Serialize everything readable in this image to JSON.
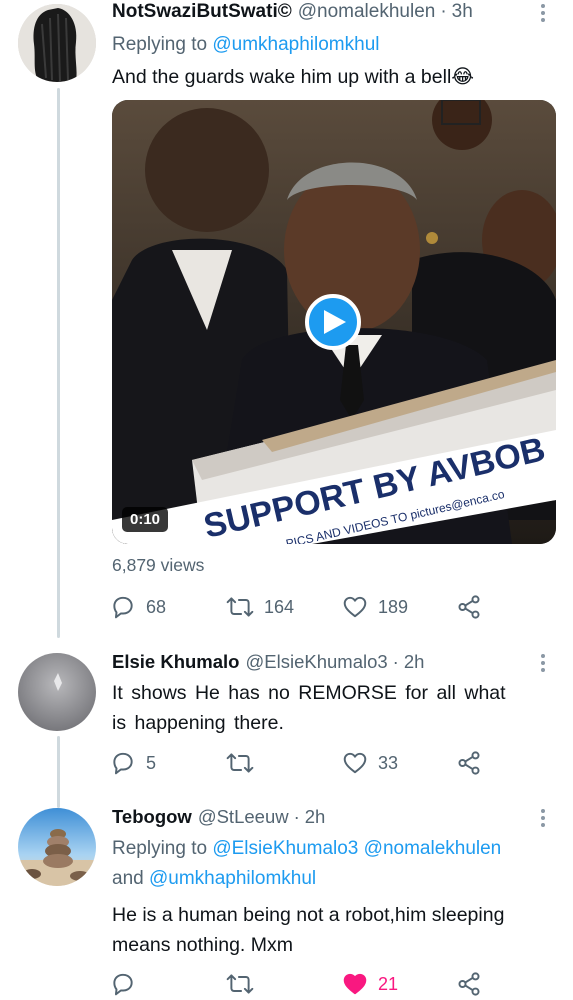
{
  "tweets": [
    {
      "name": "NotSwaziButSwati©",
      "handle": "@nomalekhulen",
      "time": "3h",
      "replying_prefix": "Replying to",
      "replying_to": "@umkhaphilomkhul",
      "text": "And the guards wake him up with a bell😂",
      "video": {
        "duration": "0:10",
        "overlay_text": "SUPPORT BY AVBOB",
        "overlay_subtext": "PICS AND VIDEOS TO pictures@enca.co"
      },
      "views": "6,879 views",
      "replies": "68",
      "retweets": "164",
      "likes": "189"
    },
    {
      "name": "Elsie Khumalo",
      "handle": "@ElsieKhumalo3",
      "time": "2h",
      "text_line1": "It shows He has no REMORSE for all what",
      "text_line2": "is happening there.",
      "replies": "5",
      "retweets": "",
      "likes": "33"
    },
    {
      "name": "Tebogow",
      "handle": "@StLeeuw",
      "time": "2h",
      "replying_prefix": "Replying to",
      "replying_to_1": "@ElsieKhumalo3",
      "replying_to_2": "@nomalekhulen",
      "replying_and": "and",
      "replying_to_3": "@umkhaphilomkhul",
      "text_line1": "He is a human being not a robot,him sleeping",
      "text_line2": "means nothing. Mxm",
      "replies": "",
      "retweets": "",
      "likes": "21",
      "liked": true
    }
  ],
  "colors": {
    "accent": "#1d9bf0",
    "secondary_text": "#536471",
    "like_active": "#f91880",
    "thread_line": "#cfd9de"
  },
  "icons": [
    "reply-icon",
    "retweet-icon",
    "like-icon",
    "share-icon",
    "more-icon",
    "play-icon"
  ]
}
